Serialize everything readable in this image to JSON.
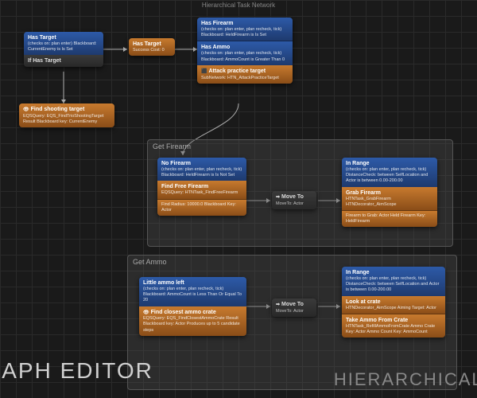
{
  "top_title": "Hierarchical Task Network",
  "big_left": "RAPH EDITOR",
  "big_right": "HIERARCHICAL T",
  "nodes": {
    "has_target_root": {
      "title": "Has Target",
      "sub": "(checks on: plan enter)\nBlackboard: CurrentEnemy is Is Set",
      "if_label": "If Has Target"
    },
    "find_shooting": {
      "title": "Find shooting target",
      "sub": "EQSQuery: EQS_FindTrioShootingTarget\nResult Blackboard key: CurrentEnemy",
      "icon": "👁"
    },
    "has_target_sel": {
      "title": "Has Target",
      "sub": "Success  Cost: 0"
    },
    "has_firearm": {
      "title": "Has Firearm",
      "sub": "(checks on: plan enter, plan recheck, tick)\nBlackboard: HeldFirearm is Is Set"
    },
    "has_ammo": {
      "title": "Has Ammo",
      "sub": "(checks on: plan enter, plan recheck, tick)\nBlackboard: AmmoCount is Greater Than 0"
    },
    "attack_target": {
      "title": "Attack practice target",
      "sub": "SubNetwork:\nHTN_AttackPracticeTarget",
      "icon": "⬛"
    },
    "group_firearm": {
      "label": "Get Firearm"
    },
    "no_firearm": {
      "title": "No Firearm",
      "sub": "(checks on: plan enter, plan recheck, tick)\nBlackboard: HeldFirearm is Is Not Set"
    },
    "find_free": {
      "title": "Find Free Firearm",
      "sub1": "EQSQuery: HTNTask_FindFreeFirearm",
      "sub2": "Find Radius: 10000.0\nBlackboard Key: Actor"
    },
    "move_to_1": {
      "title": "Move To",
      "sub": "MoveTo: Actor",
      "icon": "➡"
    },
    "in_range_1": {
      "title": "In Range",
      "sub": "(checks on: plan enter, plan recheck, tick)\nDistanceCheck: between\nSelfLocation and Actor\nis between 0.00-200.00"
    },
    "grab_firearm": {
      "title": "Grab Firearm",
      "sub1": "HTNTask_GrabFirearm\nHTNDecorator_AimScope",
      "sub2": "Firearm to Grab: Actor\nHeld Firearm Key: HeldFirearm"
    },
    "group_ammo": {
      "label": "Get Ammo"
    },
    "little_ammo": {
      "title": "Little ammo left",
      "sub": "(checks on: plan enter, plan recheck, tick)\nBlackboard: AmmoCount is Less Than Or Equal To 20"
    },
    "find_crate": {
      "title": "Find closest ammo crate",
      "sub1": "EQSQuery: EQS_FindClosestAmmoCrate\nResult Blackboard key: Actor\nProduces up to 5 candidate steps",
      "icon": "👁"
    },
    "move_to_2": {
      "title": "Move To",
      "sub": "MoveTo: Actor",
      "icon": "➡"
    },
    "in_range_2": {
      "title": "In Range",
      "sub": "(checks on: plan enter, plan recheck, tick)\nDistanceCheck: between\nSelfLocation and Actor\nis between 0.00-200.00"
    },
    "look_crate": {
      "title": "Look at crate",
      "sub": "HTNDecorator_AimScope\n\nAiming Target: Actor"
    },
    "take_ammo": {
      "title": "Take Ammo From Crate",
      "sub": "HTNTask_RefillAmmoFromCrate\n\nAmmo Crate Key: Actor\nAmmo Count Key: AmmoCount"
    }
  }
}
